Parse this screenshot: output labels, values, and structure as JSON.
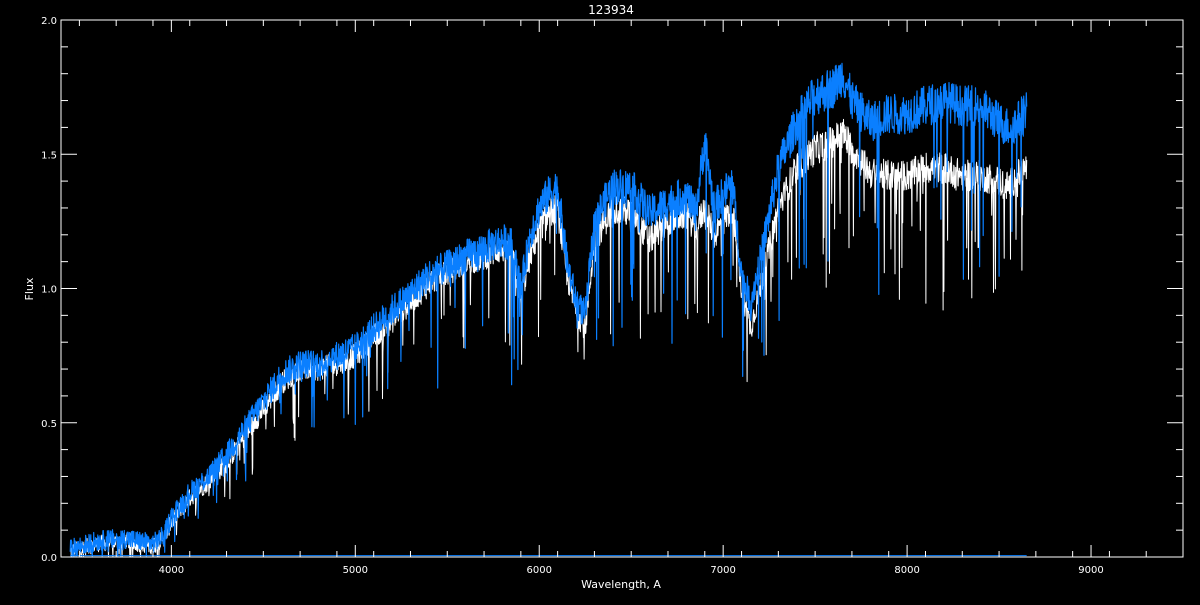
{
  "colors": {
    "background": "#000000",
    "axes": "#ffffff",
    "observed_spectrum": "#ffffff",
    "model_spectrum": "#0a7fff"
  },
  "chart_data": {
    "type": "line",
    "title": "123934",
    "xlabel": "Wavelength, A",
    "ylabel": "Flux",
    "xlim": [
      3400,
      9500
    ],
    "ylim": [
      0.0,
      2.0
    ],
    "xticks": [
      4000,
      5000,
      6000,
      7000,
      8000,
      9000
    ],
    "xtick_labels": [
      "4000",
      "5000",
      "6000",
      "7000",
      "8000",
      "9000"
    ],
    "yticks": [
      0.0,
      0.5,
      1.0,
      1.5,
      2.0
    ],
    "ytick_labels": [
      "0.0",
      "0.5",
      "1.0",
      "1.5",
      "2.0"
    ],
    "grid": false,
    "legend": "none",
    "series": [
      {
        "style": "white",
        "x": [
          3450,
          3600,
          3750,
          3900,
          3960,
          4000,
          4100,
          4200,
          4300,
          4400,
          4500,
          4600,
          4700,
          4800,
          4900,
          5000,
          5100,
          5200,
          5300,
          5400,
          5500,
          5600,
          5700,
          5800,
          5850,
          5900,
          5950,
          6000,
          6050,
          6100,
          6150,
          6200,
          6250,
          6300,
          6400,
          6500,
          6600,
          6700,
          6800,
          6850,
          6900,
          6950,
          7000,
          7050,
          7100,
          7150,
          7200,
          7300,
          7400,
          7500,
          7600,
          7650,
          7700,
          7800,
          7900,
          8000,
          8100,
          8200,
          8300,
          8400,
          8500,
          8550,
          8600,
          8650
        ],
        "y": [
          0.02,
          0.05,
          0.06,
          0.04,
          0.07,
          0.13,
          0.22,
          0.28,
          0.35,
          0.45,
          0.55,
          0.65,
          0.7,
          0.7,
          0.72,
          0.75,
          0.82,
          0.88,
          0.95,
          1.02,
          1.06,
          1.1,
          1.12,
          1.15,
          1.13,
          0.97,
          1.12,
          1.22,
          1.28,
          1.3,
          1.05,
          0.92,
          0.85,
          1.18,
          1.3,
          1.28,
          1.18,
          1.25,
          1.28,
          1.22,
          1.3,
          1.2,
          1.25,
          1.3,
          1.0,
          0.85,
          1.0,
          1.3,
          1.45,
          1.52,
          1.55,
          1.58,
          1.52,
          1.43,
          1.42,
          1.42,
          1.45,
          1.45,
          1.42,
          1.42,
          1.4,
          1.38,
          1.42,
          1.45
        ]
      },
      {
        "style": "blue",
        "x": [
          3450,
          3600,
          3750,
          3900,
          3960,
          4000,
          4100,
          4200,
          4300,
          4400,
          4500,
          4600,
          4700,
          4800,
          4900,
          5000,
          5100,
          5200,
          5300,
          5400,
          5500,
          5600,
          5700,
          5800,
          5850,
          5900,
          5950,
          6000,
          6050,
          6100,
          6150,
          6200,
          6250,
          6300,
          6400,
          6500,
          6600,
          6700,
          6800,
          6850,
          6900,
          6950,
          7000,
          7050,
          7100,
          7150,
          7200,
          7300,
          7400,
          7500,
          7600,
          7650,
          7700,
          7800,
          7900,
          8000,
          8100,
          8200,
          8300,
          8400,
          8500,
          8550,
          8600,
          8650
        ],
        "y": [
          0.03,
          0.06,
          0.07,
          0.05,
          0.08,
          0.15,
          0.24,
          0.3,
          0.38,
          0.48,
          0.58,
          0.68,
          0.72,
          0.72,
          0.75,
          0.78,
          0.85,
          0.92,
          0.98,
          1.05,
          1.08,
          1.12,
          1.15,
          1.18,
          1.16,
          1.0,
          1.2,
          1.3,
          1.35,
          1.38,
          1.1,
          0.95,
          0.9,
          1.25,
          1.38,
          1.38,
          1.28,
          1.32,
          1.35,
          1.28,
          1.55,
          1.3,
          1.35,
          1.4,
          1.05,
          0.95,
          1.1,
          1.45,
          1.62,
          1.72,
          1.75,
          1.8,
          1.7,
          1.62,
          1.65,
          1.65,
          1.68,
          1.7,
          1.68,
          1.68,
          1.62,
          1.6,
          1.62,
          1.68
        ]
      }
    ]
  }
}
